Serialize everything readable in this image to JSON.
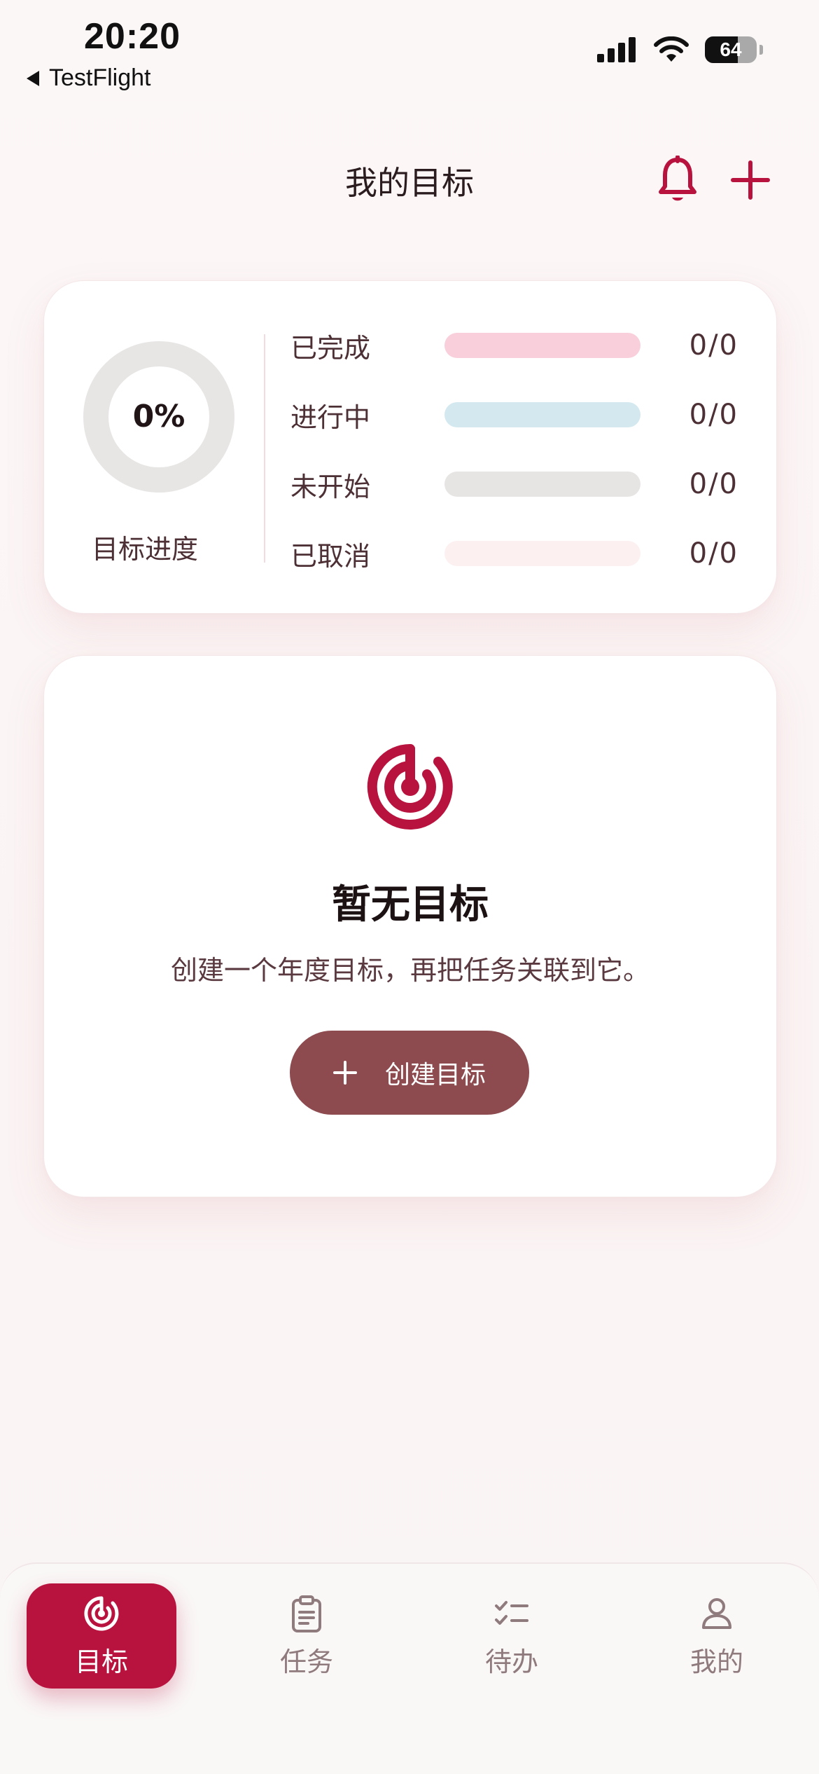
{
  "status_bar": {
    "time": "20:20",
    "back_label": "TestFlight",
    "battery": "64",
    "battery_fraction": 0.64
  },
  "header": {
    "title": "我的目标",
    "bell_icon": "bell-icon",
    "add_icon": "plus-icon"
  },
  "progress_card": {
    "percent": "0%",
    "percent_value": 0,
    "label": "目标进度",
    "rows": [
      {
        "label": "已完成",
        "count": "0/0",
        "color": "#f8cfdb"
      },
      {
        "label": "进行中",
        "count": "0/0",
        "color": "#d3e9ef"
      },
      {
        "label": "未开始",
        "count": "0/0",
        "color": "#e7e5e4"
      },
      {
        "label": "已取消",
        "count": "0/0",
        "color": "#fdf0f1"
      }
    ]
  },
  "empty_state": {
    "icon": "target-icon",
    "title": "暂无目标",
    "subtitle": "创建一个年度目标，再把任务关联到它。",
    "button_label": "创建目标"
  },
  "nav": {
    "items": [
      {
        "label": "目标",
        "icon": "target-icon",
        "active": true
      },
      {
        "label": "任务",
        "icon": "clipboard-icon",
        "active": false
      },
      {
        "label": "待办",
        "icon": "checklist-icon",
        "active": false
      },
      {
        "label": "我的",
        "icon": "person-icon",
        "active": false
      }
    ]
  },
  "colors": {
    "accent": "#b8133e",
    "button": "#8d4b50",
    "background": "#fbf5f5"
  }
}
